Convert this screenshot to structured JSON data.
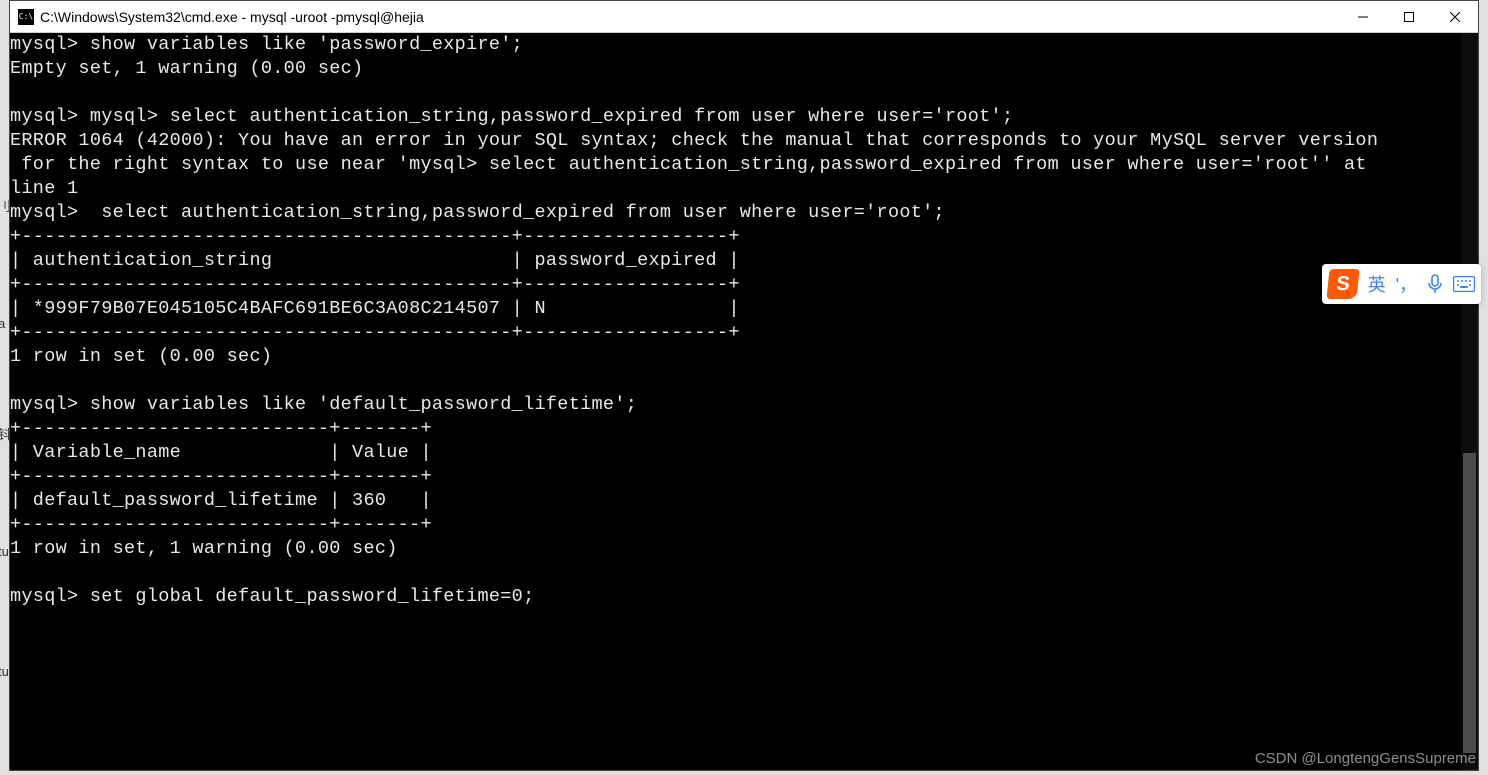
{
  "window": {
    "icon_label": "C:\\",
    "title": "C:\\Windows\\System32\\cmd.exe - mysql  -uroot -pmysql@hejia"
  },
  "terminal_lines": [
    "mysql> show variables like 'password_expire';",
    "Empty set, 1 warning (0.00 sec)",
    "",
    "mysql> mysql> select authentication_string,password_expired from user where user='root';",
    "ERROR 1064 (42000): You have an error in your SQL syntax; check the manual that corresponds to your MySQL server version",
    " for the right syntax to use near 'mysql> select authentication_string,password_expired from user where user='root'' at",
    "line 1",
    "mysql>  select authentication_string,password_expired from user where user='root';",
    "+-------------------------------------------+------------------+",
    "| authentication_string                     | password_expired |",
    "+-------------------------------------------+------------------+",
    "| *999F79B07E045105C4BAFC691BE6C3A08C214507 | N                |",
    "+-------------------------------------------+------------------+",
    "1 row in set (0.00 sec)",
    "",
    "mysql> show variables like 'default_password_lifetime';",
    "+---------------------------+-------+",
    "| Variable_name             | Value |",
    "+---------------------------+-------+",
    "| default_password_lifetime | 360   |",
    "+---------------------------+-------+",
    "1 row in set, 1 warning (0.00 sec)",
    "",
    "mysql> set global default_password_lifetime=0;"
  ],
  "ime": {
    "logo": "S",
    "lang": "英",
    "punct": "'，",
    "mic": "mic-icon",
    "kb": "keyboard-icon"
  },
  "watermark": "CSDN @LongtengGensSupreme",
  "edge": {
    "a": "刂",
    "b": "a",
    "c": "钭",
    "d": "tu",
    "e": "tu"
  }
}
